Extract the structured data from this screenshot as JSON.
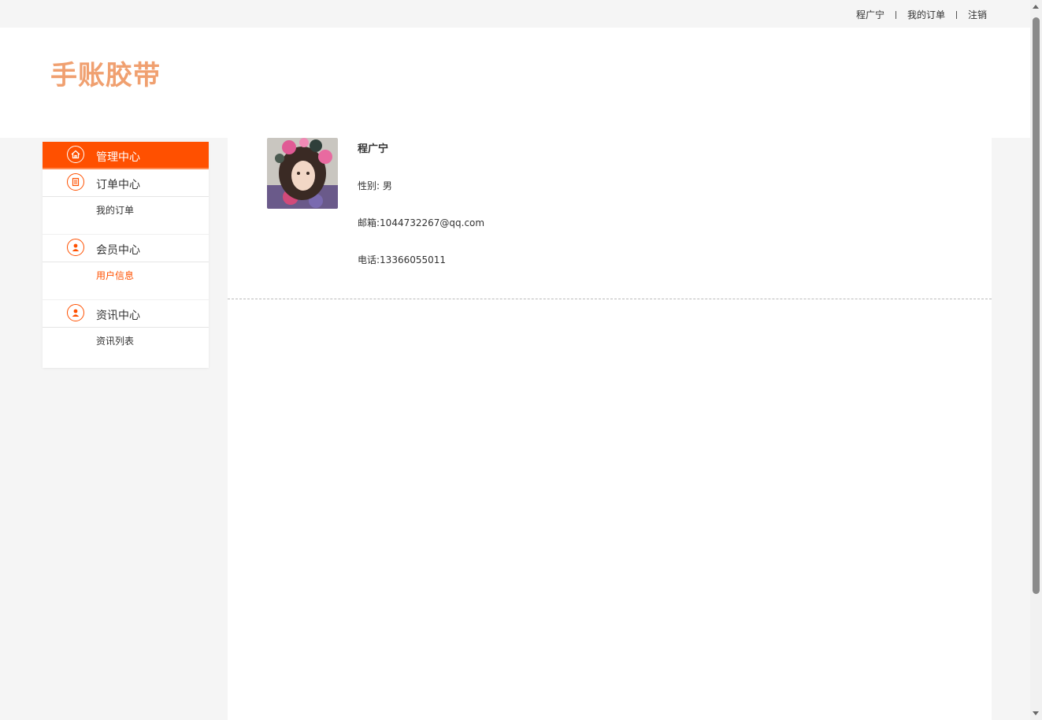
{
  "topbar": {
    "user_link": "程广宁",
    "orders_link": "我的订单",
    "logout_link": "注销"
  },
  "header": {
    "logo_text": "手账胶带"
  },
  "sidebar": {
    "sections": [
      {
        "label": "管理中心",
        "icon": "home-icon",
        "active": true
      },
      {
        "label": "订单中心",
        "icon": "document-icon",
        "sub": "我的订单"
      },
      {
        "label": "会员中心",
        "icon": "user-icon",
        "sub": "用户信息"
      },
      {
        "label": "资讯中心",
        "icon": "user-icon",
        "sub": "资讯列表"
      }
    ]
  },
  "profile": {
    "name": "程广宁",
    "gender": "性别: 男",
    "email": "邮箱:1044732267@qq.com",
    "phone": "电话:13366055011"
  },
  "colors": {
    "accent": "#ff5000",
    "logo": "#f0a070"
  }
}
